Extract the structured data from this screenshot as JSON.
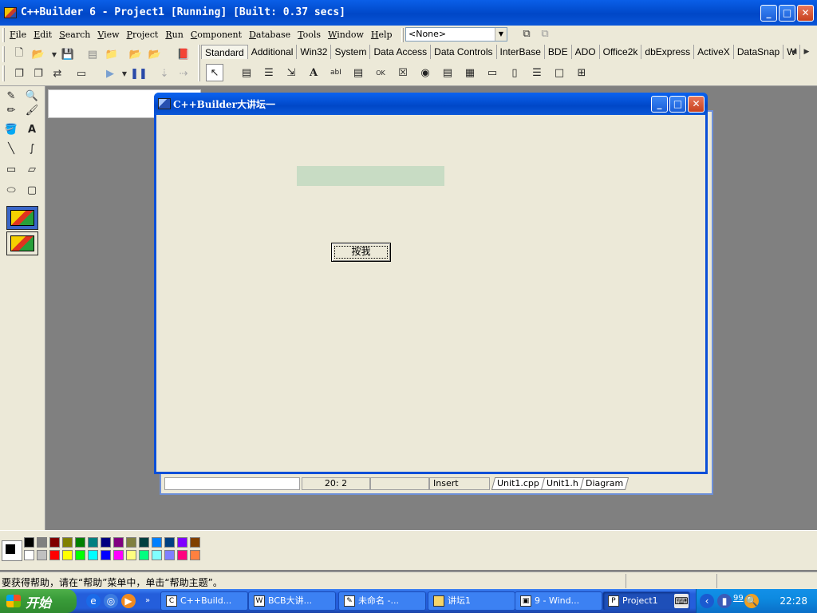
{
  "ide": {
    "title": "C++Builder 6 - Project1 [Running] [Built: 0.37 secs]",
    "menu": [
      "File",
      "Edit",
      "Search",
      "View",
      "Project",
      "Run",
      "Component",
      "Database",
      "Tools",
      "Window",
      "Help"
    ],
    "combo_value": "<None>",
    "palette_tabs": [
      "Standard",
      "Additional",
      "Win32",
      "System",
      "Data Access",
      "Data Controls",
      "InterBase",
      "BDE",
      "ADO",
      "Office2k",
      "dbExpress",
      "ActiveX",
      "DataSnap",
      "W"
    ]
  },
  "form": {
    "title": "C++Builder大讲坛一",
    "button_label": "按我"
  },
  "editor": {
    "position": "20:  2",
    "mode": "Insert",
    "tabs": [
      "Unit1.cpp",
      "Unit1.h",
      "Diagram"
    ]
  },
  "palette": {
    "colors_top": [
      "#000000",
      "#808080",
      "#800000",
      "#808000",
      "#008000",
      "#008080",
      "#000080",
      "#800080",
      "#808040",
      "#004040",
      "#0080ff",
      "#004080",
      "#8000ff",
      "#804000"
    ],
    "colors_bottom": [
      "#ffffff",
      "#c0c0c0",
      "#ff0000",
      "#ffff00",
      "#00ff00",
      "#00ffff",
      "#0000ff",
      "#ff00ff",
      "#ffff80",
      "#00ff80",
      "#80ffff",
      "#8080ff",
      "#ff0080",
      "#ff8040"
    ]
  },
  "status": {
    "help_text": "要获得帮助，请在“帮助”菜单中，单击“帮助主题”。"
  },
  "taskbar": {
    "start_label": "开始",
    "tasks": [
      "C++Build...",
      "BCB大讲...",
      "未命名 -...",
      "讲坛1",
      "9 - Wind...",
      "Project1"
    ],
    "tray_number": "99",
    "clock": "22:28"
  }
}
